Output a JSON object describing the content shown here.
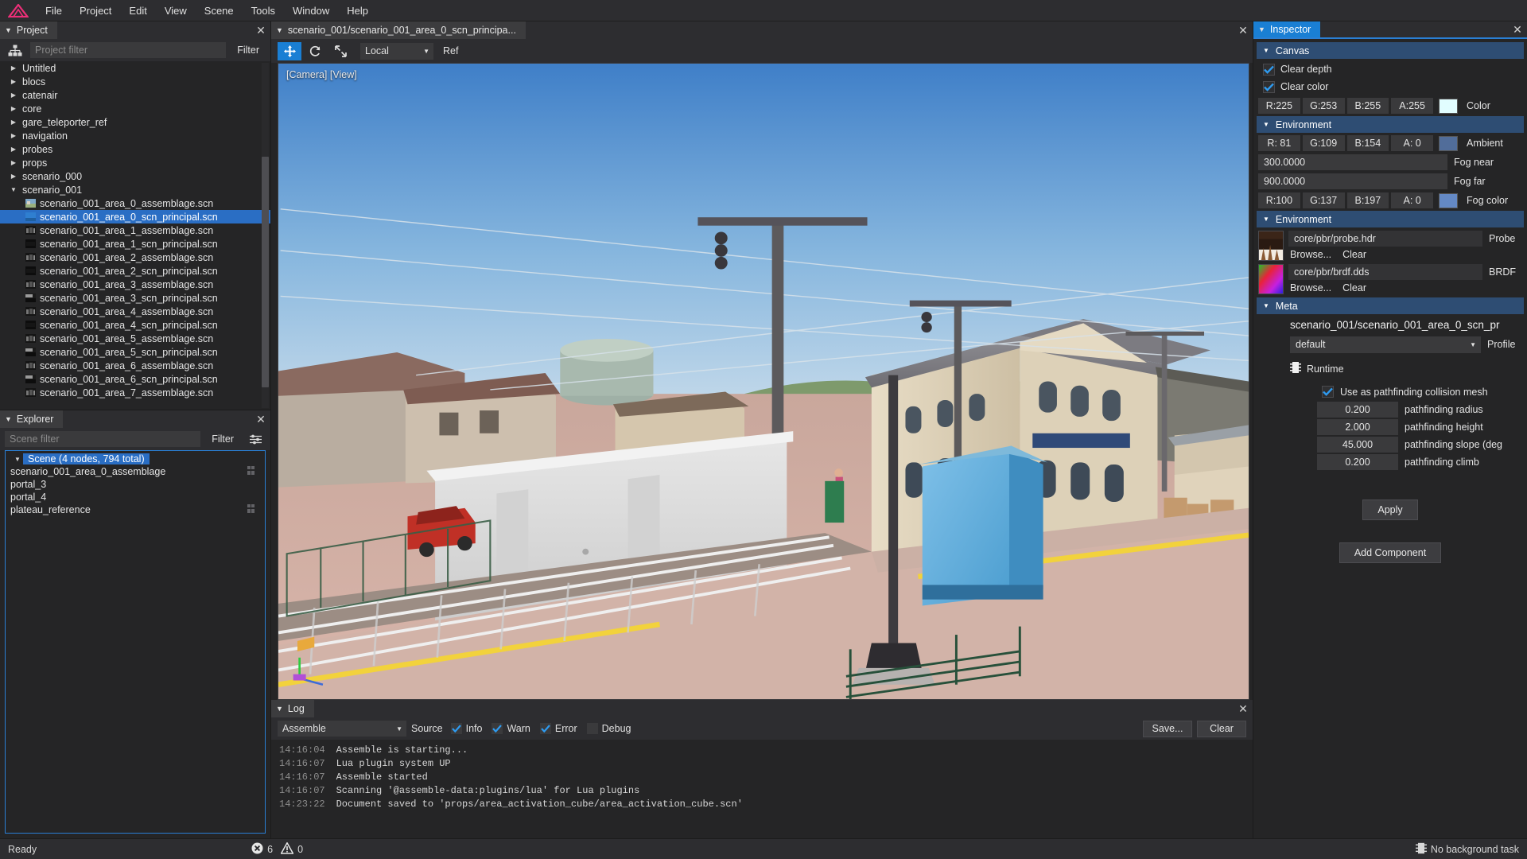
{
  "app": {
    "logo": "triangle-logo",
    "menu": [
      "File",
      "Project",
      "Edit",
      "View",
      "Scene",
      "Tools",
      "Window",
      "Help"
    ]
  },
  "project_panel": {
    "tab_label": "Project",
    "filter_placeholder": "Project filter",
    "filter_button": "Filter",
    "tree_icon": "hierarchy-icon",
    "folders": [
      {
        "label": "Untitled",
        "expanded": false
      },
      {
        "label": "blocs",
        "expanded": false
      },
      {
        "label": "catenair",
        "expanded": false
      },
      {
        "label": "core",
        "expanded": false
      },
      {
        "label": "gare_teleporter_ref",
        "expanded": false
      },
      {
        "label": "navigation",
        "expanded": false
      },
      {
        "label": "probes",
        "expanded": false
      },
      {
        "label": "props",
        "expanded": false
      },
      {
        "label": "scenario_000",
        "expanded": false
      },
      {
        "label": "scenario_001",
        "expanded": true
      }
    ],
    "files": [
      {
        "label": "scenario_001_area_0_assemblage.scn",
        "selected": false,
        "thumb": "sky"
      },
      {
        "label": "scenario_001_area_0_scn_principal.scn",
        "selected": true,
        "thumb": "blue"
      },
      {
        "label": "scenario_001_area_1_assemblage.scn",
        "selected": false,
        "thumb": "dark"
      },
      {
        "label": "scenario_001_area_1_scn_principal.scn",
        "selected": false,
        "thumb": "black"
      },
      {
        "label": "scenario_001_area_2_assemblage.scn",
        "selected": false,
        "thumb": "dark"
      },
      {
        "label": "scenario_001_area_2_scn_principal.scn",
        "selected": false,
        "thumb": "black"
      },
      {
        "label": "scenario_001_area_3_assemblage.scn",
        "selected": false,
        "thumb": "dark"
      },
      {
        "label": "scenario_001_area_3_scn_principal.scn",
        "selected": false,
        "thumb": "gray"
      },
      {
        "label": "scenario_001_area_4_assemblage.scn",
        "selected": false,
        "thumb": "dark"
      },
      {
        "label": "scenario_001_area_4_scn_principal.scn",
        "selected": false,
        "thumb": "black"
      },
      {
        "label": "scenario_001_area_5_assemblage.scn",
        "selected": false,
        "thumb": "dark"
      },
      {
        "label": "scenario_001_area_5_scn_principal.scn",
        "selected": false,
        "thumb": "gray"
      },
      {
        "label": "scenario_001_area_6_assemblage.scn",
        "selected": false,
        "thumb": "dark"
      },
      {
        "label": "scenario_001_area_6_scn_principal.scn",
        "selected": false,
        "thumb": "gray"
      },
      {
        "label": "scenario_001_area_7_assemblage.scn",
        "selected": false,
        "thumb": "dark"
      }
    ]
  },
  "explorer_panel": {
    "tab_label": "Explorer",
    "filter_placeholder": "Scene filter",
    "filter_button": "Filter",
    "options_icon": "sliders-icon",
    "root": "Scene (4 nodes, 794 total)",
    "nodes": [
      {
        "label": "scenario_001_area_0_assemblage",
        "badge": "mesh-icon"
      },
      {
        "label": "portal_3",
        "badge": ""
      },
      {
        "label": "portal_4",
        "badge": ""
      },
      {
        "label": "plateau_reference",
        "badge": "mesh-icon"
      }
    ]
  },
  "viewport_panel": {
    "tab_label": "scenario_001/scenario_001_area_0_scn_principa...",
    "toolbar": {
      "move_icon": "move-tool-icon",
      "rotate_icon": "rotate-tool-icon",
      "scale_icon": "scale-tool-icon",
      "space_value": "Local",
      "space_label": "Ref"
    },
    "overlay": "[Camera]  [View]"
  },
  "log_panel": {
    "tab_label": "Log",
    "source_value": "Assemble",
    "source_label": "Source",
    "filters": [
      {
        "label": "Info",
        "checked": true
      },
      {
        "label": "Warn",
        "checked": true
      },
      {
        "label": "Error",
        "checked": true
      },
      {
        "label": "Debug",
        "checked": false
      }
    ],
    "save_label": "Save...",
    "clear_label": "Clear",
    "lines": [
      {
        "time": "14:16:04",
        "message": "Assemble is starting..."
      },
      {
        "time": "14:16:07",
        "message": "Lua plugin system UP"
      },
      {
        "time": "14:16:07",
        "message": "Assemble started"
      },
      {
        "time": "14:16:07",
        "message": "Scanning '@assemble-data:plugins/lua' for Lua plugins"
      },
      {
        "time": "14:23:22",
        "message": "Document saved to 'props/area_activation_cube/area_activation_cube.scn'"
      }
    ]
  },
  "inspector": {
    "tab_label": "Inspector",
    "canvas": {
      "title": "Canvas",
      "clear_depth_label": "Clear depth",
      "clear_depth_checked": true,
      "clear_color_label": "Clear color",
      "clear_color_checked": true,
      "color_label": "Color",
      "color_r": "R:225",
      "color_g": "G:253",
      "color_b": "B:255",
      "color_a": "A:255",
      "color_hex": "#e1fdff"
    },
    "environment": {
      "title": "Environment",
      "ambient_label": "Ambient",
      "ambient_r": "R: 81",
      "ambient_g": "G:109",
      "ambient_b": "B:154",
      "ambient_a": "A:  0",
      "ambient_hex": "#516d9a",
      "fog_near_value": "300.0000",
      "fog_near_label": "Fog near",
      "fog_far_value": "900.0000",
      "fog_far_label": "Fog far",
      "fog_color_label": "Fog color",
      "fog_r": "R:100",
      "fog_g": "G:137",
      "fog_b": "B:197",
      "fog_a": "A:  0",
      "fog_hex": "#6489c5"
    },
    "environment2": {
      "title": "Environment",
      "probe_path": "core/pbr/probe.hdr",
      "probe_kind": "Probe",
      "probe_browse": "Browse...",
      "probe_clear": "Clear",
      "brdf_path": "core/pbr/brdf.dds",
      "brdf_kind": "BRDF",
      "brdf_browse": "Browse...",
      "brdf_clear": "Clear"
    },
    "meta": {
      "title": "Meta",
      "path": "scenario_001/scenario_001_area_0_scn_pr",
      "profile_value": "default",
      "profile_label": "Profile",
      "runtime_label": "Runtime",
      "runtime_icon": "chip-icon",
      "pathfinding_mesh_label": "Use as pathfinding collision mesh",
      "pathfinding_mesh_checked": true,
      "fields": [
        {
          "value": "0.200",
          "label": "pathfinding radius"
        },
        {
          "value": "2.000",
          "label": "pathfinding height"
        },
        {
          "value": "45.000",
          "label": "pathfinding slope (deg"
        },
        {
          "value": "0.200",
          "label": "pathfinding climb"
        }
      ],
      "apply_label": "Apply",
      "add_component_label": "Add Component"
    }
  },
  "statusbar": {
    "ready": "Ready",
    "error_icon": "error-icon",
    "error_count": "6",
    "warn_icon": "warning-icon",
    "warn_count": "0",
    "task_icon": "task-icon",
    "task_text": "No background task"
  },
  "colors": {
    "accent": "#1a7fd4",
    "selection": "#2a6ec4",
    "section_header": "#2e4d73",
    "panel_bg": "#252526",
    "toolbar_bg": "#2d2d30",
    "logo_pink": "#ee2f78"
  }
}
